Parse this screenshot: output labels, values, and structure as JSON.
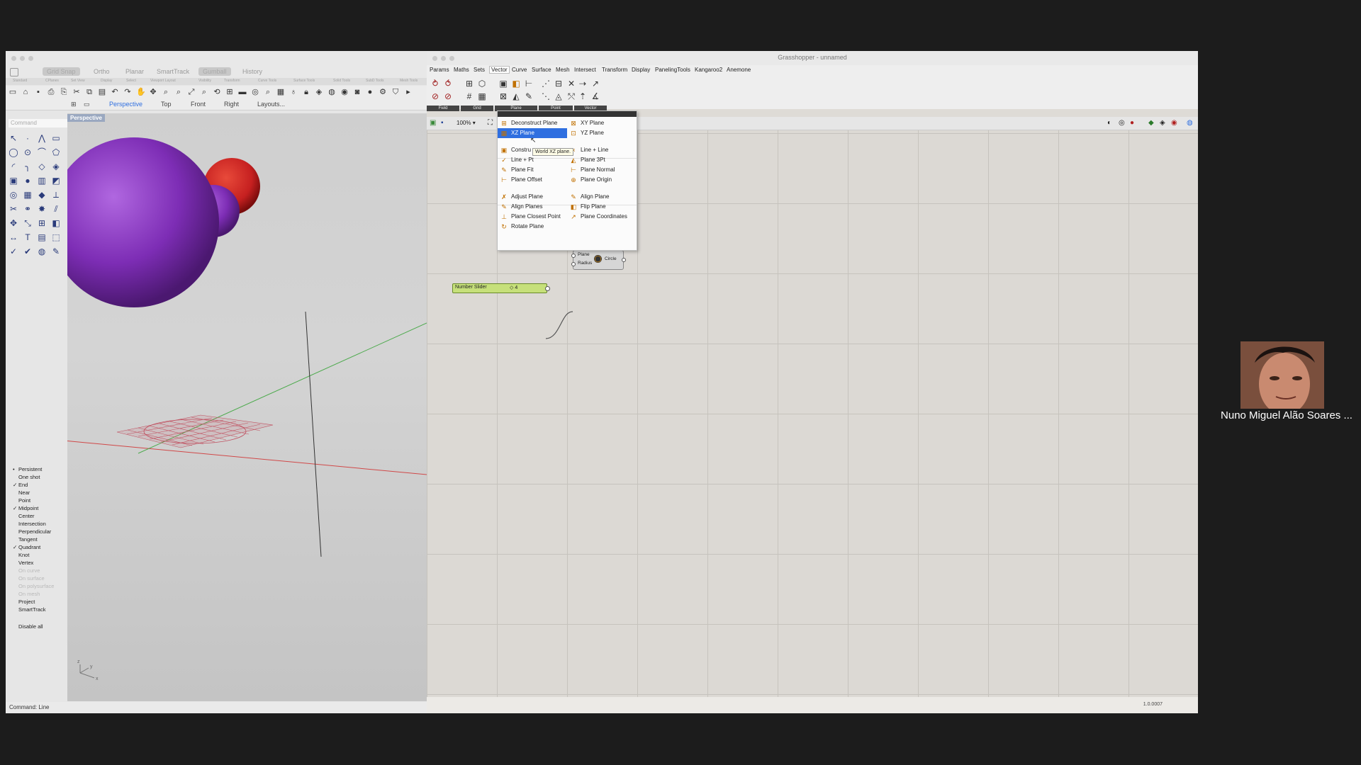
{
  "rhino": {
    "modes": [
      "Grid Snap",
      "Ortho",
      "Planar",
      "SmartTrack",
      "Gumball",
      "History"
    ],
    "toolbar_tabs": [
      "Standard",
      "CPlanes",
      "Set View",
      "Display",
      "Select",
      "Viewport Layout",
      "Visibility",
      "Transform",
      "Curve Tools",
      "Surface Tools",
      "Solid Tools",
      "SubD Tools",
      "Mesh Tools"
    ],
    "view_tabs": [
      "Perspective",
      "Top",
      "Front",
      "Right",
      "Layouts..."
    ],
    "command_placeholder": "Command",
    "viewport_label": "Perspective",
    "osnaps": [
      {
        "label": "Persistent",
        "state": "dot"
      },
      {
        "label": "One shot",
        "state": ""
      },
      {
        "label": "End",
        "state": "check"
      },
      {
        "label": "Near",
        "state": ""
      },
      {
        "label": "Point",
        "state": ""
      },
      {
        "label": "Midpoint",
        "state": "check"
      },
      {
        "label": "Center",
        "state": ""
      },
      {
        "label": "Intersection",
        "state": ""
      },
      {
        "label": "Perpendicular",
        "state": ""
      },
      {
        "label": "Tangent",
        "state": ""
      },
      {
        "label": "Quadrant",
        "state": "check"
      },
      {
        "label": "Knot",
        "state": ""
      },
      {
        "label": "Vertex",
        "state": ""
      },
      {
        "label": "On curve",
        "state": "dim"
      },
      {
        "label": "On surface",
        "state": "dim"
      },
      {
        "label": "On polysurface",
        "state": "dim"
      },
      {
        "label": "On mesh",
        "state": "dim"
      },
      {
        "label": "Project",
        "state": ""
      },
      {
        "label": "SmartTrack",
        "state": ""
      },
      {
        "label": "Disable all",
        "state": ""
      }
    ],
    "status": "Command: Line",
    "axis_labels": {
      "z": "z",
      "y": "y",
      "x": "x"
    },
    "colors": {
      "sphere": "#7d2db5",
      "red_sphere": "#c62020"
    }
  },
  "gh": {
    "title": "Grasshopper - unnamed",
    "menus": [
      "Params",
      "Maths",
      "Sets",
      "Vector",
      "Curve",
      "Surface",
      "Mesh",
      "Intersect",
      "Transform",
      "Display",
      "PanelingTools",
      "Kangaroo2",
      "Anemone"
    ],
    "active_menu": "Vector",
    "groups": [
      "Field",
      "Grid",
      "Plane",
      "Point",
      "Vector"
    ],
    "zoom": "100%",
    "version": "1.0.0007",
    "dropdown": {
      "left": [
        {
          "label": "Deconstruct Plane",
          "icon": "⊞"
        },
        {
          "label": "XZ Plane",
          "icon": "▦"
        },
        {
          "label": "Constru",
          "icon": "▣"
        },
        {
          "label": "Line + Pt",
          "icon": "✓"
        },
        {
          "label": "Plane Fit",
          "icon": "✎"
        },
        {
          "label": "Plane Offset",
          "icon": "⊢"
        },
        {
          "label": "Adjust Plane",
          "icon": "✗"
        },
        {
          "label": "Align Planes",
          "icon": "✎"
        },
        {
          "label": "Plane Closest Point",
          "icon": "⊥"
        },
        {
          "label": "Rotate Plane",
          "icon": "↻"
        }
      ],
      "right": [
        {
          "label": "XY Plane",
          "icon": "⊠"
        },
        {
          "label": "YZ Plane",
          "icon": "⊡"
        },
        {
          "label": "Line + Line",
          "icon": "×"
        },
        {
          "label": "Plane 3Pt",
          "icon": "◭"
        },
        {
          "label": "Plane Normal",
          "icon": "⊢"
        },
        {
          "label": "Plane Origin",
          "icon": "⊕"
        },
        {
          "label": "Align Plane",
          "icon": "✎"
        },
        {
          "label": "Flip Plane",
          "icon": "◧"
        },
        {
          "label": "Plane Coordinates",
          "icon": "↗"
        }
      ],
      "tooltip": "World XZ plane."
    },
    "slider": {
      "label": "Number Slider",
      "value": "◇ 4"
    },
    "circle_node": {
      "inputs": [
        "Plane",
        "Radius"
      ],
      "output": "Circle"
    }
  },
  "webcam": {
    "name": "Nuno Miguel Alão Soares ..."
  }
}
